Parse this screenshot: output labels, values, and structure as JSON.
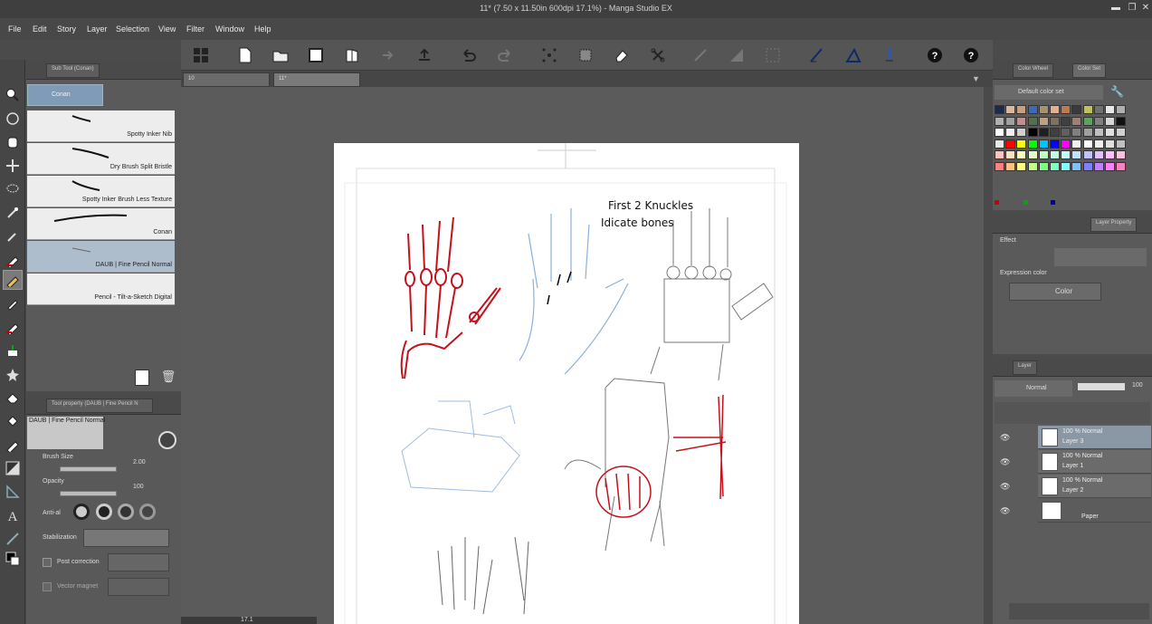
{
  "app": {
    "title": "11* (7.50 x 11.50in 600dpi 17.1%) - Manga Studio EX",
    "zoom": "17.1"
  },
  "menu": [
    "File",
    "Edit",
    "Story",
    "Layer",
    "Selection",
    "View",
    "Filter",
    "Window",
    "Help"
  ],
  "doc_tabs": [
    {
      "label": "10"
    },
    {
      "label": "11*"
    }
  ],
  "subtool": {
    "tab_label": "Sub Tool (Conan)",
    "active_brush": "Conan",
    "brushes": [
      "Spotty Inker Nib",
      "Dry Brush Split Bristle",
      "Spotty Inker Brush Less Texture",
      "Conan",
      "DAUB | Fine Pencil Normal",
      "Pencil - Tilt-a-Sketch Digital"
    ]
  },
  "toolprop": {
    "tab_label": "Tool property (DAUB | Fine Pencil N",
    "brush_name": "DAUB | Fine Pencil Normal",
    "brush_size_label": "Brush Size",
    "brush_size": "2.00",
    "opacity_label": "Opacity",
    "opacity": "100",
    "antialias_label": "Anti-al",
    "stabilization_label": "Stabilization",
    "post_correction_label": "Post correction",
    "vector_magnet_label": "Vector magnet"
  },
  "colorset": {
    "tab1": "Color Wheel",
    "tab2": "Color Set",
    "set_name": "Default color set",
    "swatches": [
      "#1e2a4a",
      "#d8b8a0",
      "#c8a080",
      "#3a6ab8",
      "#a89070",
      "#e0b090",
      "#c07850",
      "#3a3a3a",
      "#c0c060",
      "#707070",
      "#e8e8e8",
      "#b0b0b0",
      "#b0b0b0",
      "#a0a0a0",
      "#c09090",
      "#507050",
      "#c0a080",
      "#807060",
      "#404040",
      "#a08070",
      "#60a060",
      "#808080",
      "#d8d8d8",
      "#101010",
      "#ffffff",
      "#f0f0f0",
      "#d0d0d0",
      "#000000",
      "#202020",
      "#404040",
      "#606060",
      "#808080",
      "#a0a0a0",
      "#c0c0c0",
      "#e0e0e0",
      "#d0d0d0",
      "#e8e8e8",
      "#ff0000",
      "#ffff00",
      "#00ff00",
      "#00c0ff",
      "#0000ff",
      "#ff00ff",
      "#f0f0f0",
      "#ffffff",
      "#f0f0f0",
      "#e0e0e0",
      "#c0c0c0",
      "#ffc0c0",
      "#ffe0c0",
      "#ffffc0",
      "#e0ffc0",
      "#c0ffc0",
      "#c0ffe0",
      "#c0ffff",
      "#c0e0ff",
      "#c0c0ff",
      "#e0c0ff",
      "#ffc0ff",
      "#ffc0e0",
      "#ff8080",
      "#ffc080",
      "#ffff80",
      "#c0ff80",
      "#80ff80",
      "#80ffc0",
      "#80ffff",
      "#80c0ff",
      "#8080ff",
      "#c080ff",
      "#ff80ff",
      "#ff80c0"
    ]
  },
  "layerprop": {
    "tab1": "Layer Property",
    "effect_label": "Effect",
    "expression_color_label": "Expression color",
    "expression_color": "Color"
  },
  "layers": {
    "blend_mode": "Normal",
    "opacity": "100",
    "tab_label": "Layer",
    "items": [
      {
        "pct": "100 % Normal",
        "name": "Layer 3"
      },
      {
        "pct": "100 % Normal",
        "name": "Layer 1"
      },
      {
        "pct": "100 % Normal",
        "name": "Layer 2"
      },
      {
        "pct": "",
        "name": "Paper"
      }
    ]
  },
  "canvas": {
    "note1": "First 2 Knuckles",
    "note2": "Idicate bones"
  }
}
